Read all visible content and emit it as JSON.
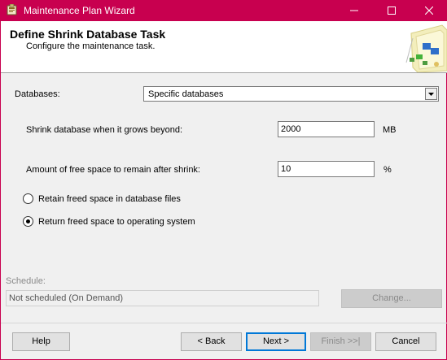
{
  "window": {
    "title": "Maintenance Plan Wizard"
  },
  "header": {
    "title": "Define Shrink Database Task",
    "subtitle": "Configure the maintenance task."
  },
  "form": {
    "databases_label": "Databases:",
    "databases_value": "Specific databases",
    "shrink_label": "Shrink database when it grows beyond:",
    "shrink_value": "2000",
    "shrink_unit": "MB",
    "free_space_label": "Amount of free space to remain after shrink:",
    "free_space_value": "10",
    "free_space_unit": "%",
    "radio_retain_label": "Retain freed space in database files",
    "radio_return_label": "Return freed space to operating system",
    "selected_radio": "return"
  },
  "schedule": {
    "label": "Schedule:",
    "value": "Not scheduled (On Demand)",
    "change_label": "Change..."
  },
  "buttons": {
    "help": "Help",
    "back": "< Back",
    "next": "Next >",
    "finish": "Finish >>|",
    "cancel": "Cancel"
  },
  "colors": {
    "titlebar": "#c8004f",
    "accent_focus": "#0078d7"
  }
}
